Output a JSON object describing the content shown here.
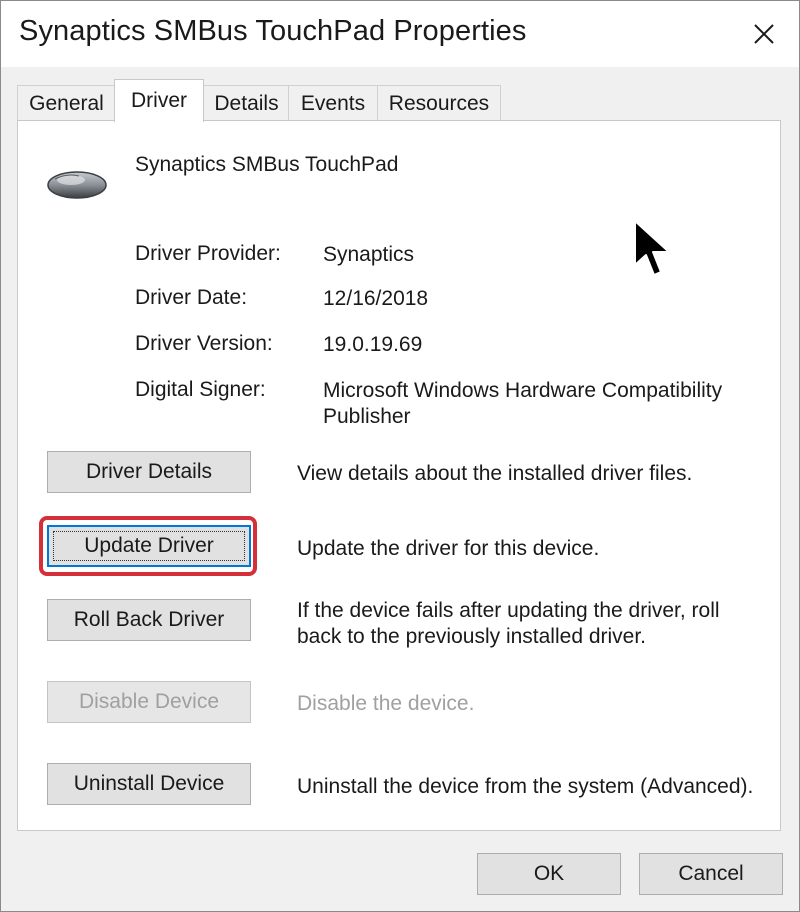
{
  "window": {
    "title": "Synaptics SMBus TouchPad Properties"
  },
  "tabs": [
    {
      "label": "General",
      "active": false
    },
    {
      "label": "Driver",
      "active": true
    },
    {
      "label": "Details",
      "active": false
    },
    {
      "label": "Events",
      "active": false
    },
    {
      "label": "Resources",
      "active": false
    }
  ],
  "device": {
    "name": "Synaptics SMBus TouchPad",
    "icon": "touchpad-mouse-icon"
  },
  "driver_info": [
    {
      "label": "Driver Provider:",
      "value": "Synaptics"
    },
    {
      "label": "Driver Date:",
      "value": "12/16/2018"
    },
    {
      "label": "Driver Version:",
      "value": "19.0.19.69"
    },
    {
      "label": "Digital Signer:",
      "value": "Microsoft Windows Hardware Compatibility Publisher"
    }
  ],
  "actions": [
    {
      "label": "Driver Details",
      "description": "View details about the installed driver files.",
      "enabled": true
    },
    {
      "label": "Update Driver",
      "description": "Update the driver for this device.",
      "enabled": true,
      "focused": true
    },
    {
      "label": "Roll Back Driver",
      "description": "If the device fails after updating the driver, roll back to the previously installed driver.",
      "enabled": true
    },
    {
      "label": "Disable Device",
      "description": "Disable the device.",
      "enabled": false
    },
    {
      "label": "Uninstall Device",
      "description": "Uninstall the device from the system (Advanced).",
      "enabled": true
    }
  ],
  "footer": {
    "ok_label": "OK",
    "cancel_label": "Cancel"
  },
  "colors": {
    "highlight": "#d4303a",
    "focus": "#0078d7"
  }
}
